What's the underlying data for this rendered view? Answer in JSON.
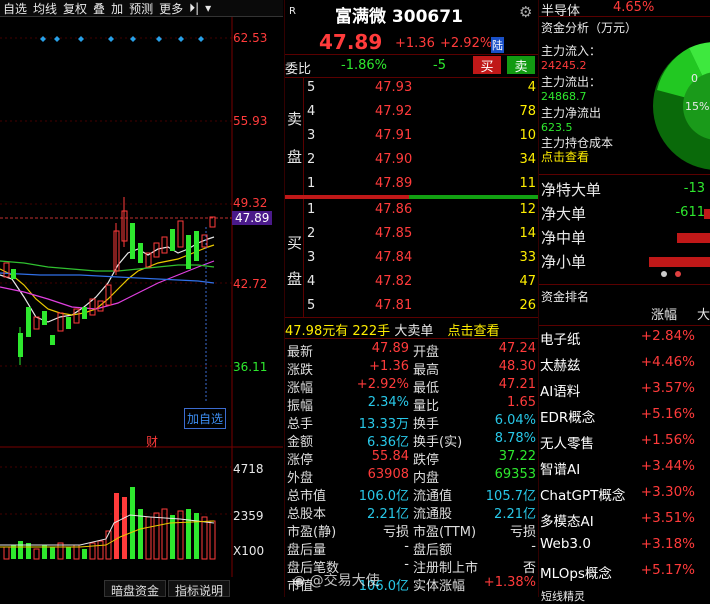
{
  "toolbar": {
    "items": [
      "自选",
      "均线",
      "复权",
      "叠",
      "加",
      "预测",
      "更多"
    ],
    "arrow_icon": "pin-arrow-icon"
  },
  "chart": {
    "price_levels": [
      "62.53",
      "55.93",
      "49.32",
      "47.89",
      "42.72",
      "36.11"
    ],
    "volume_levels": [
      "4718",
      "2359",
      "X100"
    ],
    "add_fav_label": "加自选",
    "fin_marker": "财",
    "bottom_tabs": [
      "暗盘资金",
      "指标说明"
    ]
  },
  "stock": {
    "badge": "R",
    "name": "富满微",
    "code": "300671",
    "price": "47.89",
    "change": "+1.36",
    "change_pct": "+2.92%",
    "market_badge": "陆"
  },
  "ratio": {
    "label": "委比",
    "value": "-1.86%",
    "diff": "-5",
    "buy_label": "买",
    "sell_label": "卖"
  },
  "sell_side": {
    "label_chars": [
      "卖",
      "盘"
    ],
    "rows": [
      {
        "lvl": "5",
        "price": "47.93",
        "vol": "4"
      },
      {
        "lvl": "4",
        "price": "47.92",
        "vol": "78"
      },
      {
        "lvl": "3",
        "price": "47.91",
        "vol": "10"
      },
      {
        "lvl": "2",
        "price": "47.90",
        "vol": "34"
      },
      {
        "lvl": "1",
        "price": "47.89",
        "vol": "11"
      }
    ]
  },
  "buy_side": {
    "label_chars": [
      "买",
      "盘"
    ],
    "rows": [
      {
        "lvl": "1",
        "price": "47.86",
        "vol": "12"
      },
      {
        "lvl": "2",
        "price": "47.85",
        "vol": "14"
      },
      {
        "lvl": "3",
        "price": "47.84",
        "vol": "33"
      },
      {
        "lvl": "4",
        "price": "47.82",
        "vol": "47"
      },
      {
        "lvl": "5",
        "price": "47.81",
        "vol": "26"
      }
    ]
  },
  "big_order": {
    "amount": "47.98元有",
    "hands": "222手",
    "text": "大卖单",
    "link": "点击查看"
  },
  "quote": [
    {
      "k1": "最新",
      "v1": "47.89",
      "c1": "red",
      "k2": "开盘",
      "v2": "47.24",
      "c2": "red"
    },
    {
      "k1": "涨跌",
      "v1": "+1.36",
      "c1": "red",
      "k2": "最高",
      "v2": "48.30",
      "c2": "red"
    },
    {
      "k1": "涨幅",
      "v1": "+2.92%",
      "c1": "red",
      "k2": "最低",
      "v2": "47.21",
      "c2": "red"
    },
    {
      "k1": "振幅",
      "v1": "2.34%",
      "c1": "cyan",
      "k2": "量比",
      "v2": "1.65",
      "c2": "red"
    },
    {
      "k1": "总手",
      "v1": "13.33万",
      "c1": "cyan",
      "k2": "换手",
      "v2": "6.04%",
      "c2": "cyan"
    },
    {
      "k1": "金额",
      "v1": "6.36亿",
      "c1": "cyan",
      "k2": "换手(实)",
      "v2": "8.78%",
      "c2": "cyan"
    },
    {
      "k1": "涨停",
      "v1": "55.84",
      "c1": "red",
      "k2": "跌停",
      "v2": "37.22",
      "c2": "green"
    },
    {
      "k1": "外盘",
      "v1": "63908",
      "c1": "red",
      "k2": "内盘",
      "v2": "69353",
      "c2": "green"
    },
    {
      "k1": "总市值",
      "v1": "106.0亿",
      "c1": "cyan",
      "k2": "流通值",
      "v2": "105.7亿",
      "c2": "cyan"
    },
    {
      "k1": "总股本",
      "v1": "2.21亿",
      "c1": "cyan",
      "k2": "流通股",
      "v2": "2.21亿",
      "c2": "cyan"
    },
    {
      "k1": "市盈(静)",
      "v1": "亏损",
      "c1": "white",
      "k2": "市盈(TTM)",
      "v2": "亏损",
      "c2": "white"
    },
    {
      "k1": "盘后量",
      "v1": "-",
      "c1": "white",
      "k2": "盘后额",
      "v2": "-",
      "c2": "white"
    },
    {
      "k1": "盘后笔数",
      "v1": "-",
      "c1": "white",
      "k2": "注册制上市",
      "v2": "否",
      "c2": "white"
    },
    {
      "k1": "市值",
      "v1": "106.0亿",
      "c1": "cyan",
      "k2": "实体涨幅",
      "v2": "+1.38%",
      "c2": "red"
    }
  ],
  "watermark": "@交易大使",
  "sector": {
    "name": "半导体",
    "pct": "4.65%"
  },
  "fund": {
    "title": "资金分析（万元）",
    "inflow_label": "主力流入：",
    "inflow": "24245.2",
    "outflow_label": "主力流出：",
    "outflow": "24868.7",
    "net_label": "主力净流出",
    "net": "623.5",
    "cost_label": "主力持仓成本",
    "cost_link": "点击查看",
    "pie_pcts": [
      "15%",
      "0"
    ]
  },
  "net_orders": [
    {
      "label": "净特大单",
      "value": "-13",
      "bar": 0.0
    },
    {
      "label": "净大单",
      "value": "-611",
      "bar": 0.12
    },
    {
      "label": "净中单",
      "value": "",
      "bar": 0.55
    },
    {
      "label": "净小单",
      "value": "",
      "bar": 1.0
    }
  ],
  "ranking": {
    "title": "资金排名",
    "col_change": "涨幅",
    "col_more": "大",
    "rows": [
      {
        "name": "电子纸",
        "pct": "+2.84%"
      },
      {
        "name": "太赫兹",
        "pct": "+4.46%"
      },
      {
        "name": "AI语料",
        "pct": "+3.57%"
      },
      {
        "name": "EDR概念",
        "pct": "+5.16%"
      },
      {
        "name": "无人零售",
        "pct": "+1.56%"
      },
      {
        "name": "智谱AI",
        "pct": "+3.44%"
      },
      {
        "name": "ChatGPT概念",
        "pct": "+3.30%"
      },
      {
        "name": "多模态AI",
        "pct": "+3.51%"
      },
      {
        "name": "Web3.0",
        "pct": "+3.18%"
      },
      {
        "name": "MLOps概念",
        "pct": "+5.17%"
      }
    ],
    "footer": "短线精灵"
  },
  "colors": {
    "up": "#ff3b3b",
    "down": "#2ee82e",
    "accent_blue": "#28c8e8",
    "yellow": "#ffee00"
  }
}
